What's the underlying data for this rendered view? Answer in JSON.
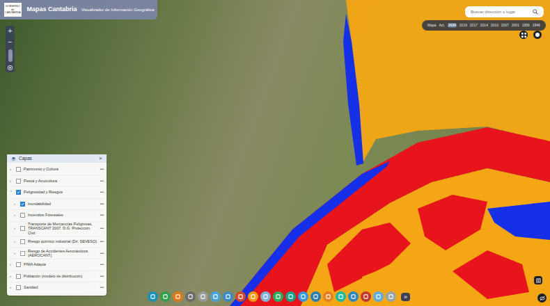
{
  "header": {
    "logo": "GOBIERNO de CANTABRIA",
    "title": "Mapas Cantabria",
    "subtitle": "Visualizador de Información Geográfica"
  },
  "search": {
    "placeholder": "Buscar dirección o lugar"
  },
  "timeline": [
    {
      "label": "Mapa",
      "selected": false
    },
    {
      "label": "Act.",
      "selected": false
    },
    {
      "label": "2020",
      "selected": true
    },
    {
      "label": "2019",
      "selected": false
    },
    {
      "label": "2017",
      "selected": false
    },
    {
      "label": "2014",
      "selected": false
    },
    {
      "label": "2010",
      "selected": false
    },
    {
      "label": "2007",
      "selected": false
    },
    {
      "label": "2001",
      "selected": false
    },
    {
      "label": "1956",
      "selected": false
    },
    {
      "label": "1946",
      "selected": false
    }
  ],
  "zoom": {
    "in": "+",
    "out": "−"
  },
  "layers_panel": {
    "title": "Capas",
    "close": "×",
    "items": [
      {
        "label": "Patrimonio y Cultura",
        "kind": "group",
        "checked": false,
        "expanded": false,
        "menu": "•••"
      },
      {
        "label": "Pesca y Acuicultura",
        "kind": "group",
        "checked": false,
        "expanded": false,
        "menu": "•••"
      },
      {
        "label": "Peligrosidad y Riesgos",
        "kind": "group",
        "checked": true,
        "expanded": true,
        "menu": "•••"
      },
      {
        "label": "Inundabilidad",
        "kind": "layer",
        "checked": true,
        "expanded": false,
        "menu": "•••"
      },
      {
        "label": "Incendios Forestales",
        "kind": "layer",
        "checked": false,
        "expanded": false,
        "menu": "•••"
      },
      {
        "label": "Transporte de Mercancías Peligrosas, TRANSCANT 2007. D.G. Protección Civil",
        "kind": "layer",
        "checked": false,
        "expanded": false,
        "menu": "•••"
      },
      {
        "label": "Riesgo químico industrial (Dir. SEVESO)",
        "kind": "layer",
        "checked": false,
        "expanded": false,
        "menu": "•••"
      },
      {
        "label": "Riesgo de Accidentes Aeronáuticos (AEROCANT)",
        "kind": "layer",
        "checked": false,
        "expanded": false,
        "menu": "•••"
      },
      {
        "label": "PIMA Adapta",
        "kind": "group",
        "checked": false,
        "expanded": false,
        "menu": "•••"
      },
      {
        "label": "Población (modelo de distribución)",
        "kind": "group",
        "checked": false,
        "expanded": false,
        "menu": "•••"
      },
      {
        "label": "Sanidad",
        "kind": "group",
        "checked": false,
        "expanded": false,
        "menu": "•••"
      }
    ]
  },
  "toolbar": [
    {
      "color": "#1a8fb5"
    },
    {
      "color": "#2ea04b"
    },
    {
      "color": "#e07b1a"
    },
    {
      "color": "#6b6b6b"
    },
    {
      "color": "#9a9a9a"
    },
    {
      "color": "#4aa3d8"
    },
    {
      "color": "#3b8bc4"
    },
    {
      "color": "#d14a2a"
    },
    {
      "color": "#f39c12"
    },
    {
      "color": "#7fb3d5"
    },
    {
      "color": "#27ae60"
    },
    {
      "color": "#16a085"
    },
    {
      "color": "#3498db"
    },
    {
      "color": "#2c7cb0"
    },
    {
      "color": "#e67e22"
    },
    {
      "color": "#1abc9c"
    },
    {
      "color": "#2e86c1"
    },
    {
      "color": "#c0392b"
    },
    {
      "color": "#5dade2"
    },
    {
      "color": "#95a5a6"
    }
  ],
  "toolbar_more": "»"
}
